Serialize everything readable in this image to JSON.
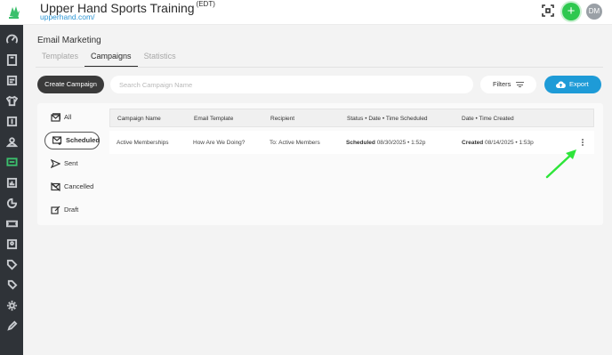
{
  "header": {
    "brand_name": "Upper Hand Sports Training",
    "brand_tz": "(EDT)",
    "brand_url": "upperhand.com/",
    "avatar_initials": "DM",
    "add_label": "+"
  },
  "sidebar": {
    "items": [
      {
        "icon": "dashboard-icon",
        "active": false
      },
      {
        "icon": "book-icon",
        "active": false
      },
      {
        "icon": "calendar-icon",
        "active": false
      },
      {
        "icon": "shirt-icon",
        "active": false
      },
      {
        "icon": "dollar-icon",
        "active": false
      },
      {
        "icon": "users-icon",
        "active": false
      },
      {
        "icon": "message-icon",
        "active": true
      },
      {
        "icon": "reports-icon",
        "active": false
      },
      {
        "icon": "chart-icon",
        "active": false
      },
      {
        "icon": "ticket-icon",
        "active": false
      },
      {
        "icon": "id-card-icon",
        "active": false
      },
      {
        "icon": "tag-icon",
        "active": false
      },
      {
        "icon": "tags-icon",
        "active": false
      },
      {
        "icon": "gear-icon",
        "active": false
      },
      {
        "icon": "edit-icon",
        "active": false
      }
    ]
  },
  "page": {
    "title": "Email Marketing",
    "tabs": [
      "Templates",
      "Campaigns",
      "Statistics"
    ],
    "active_tab": "Campaigns"
  },
  "toolbar": {
    "create_label": "Create Campaign",
    "search_placeholder": "Search Campaign Name",
    "filters_label": "Filters",
    "export_label": "Export"
  },
  "status_filters": [
    {
      "label": "All",
      "icon": "mail-all-icon",
      "active": false
    },
    {
      "label": "Scheduled",
      "icon": "mail-scheduled-icon",
      "active": true
    },
    {
      "label": "Sent",
      "icon": "send-icon",
      "active": false
    },
    {
      "label": "Cancelled",
      "icon": "mail-cancelled-icon",
      "active": false
    },
    {
      "label": "Draft",
      "icon": "draft-icon",
      "active": false
    }
  ],
  "table": {
    "columns": [
      "Campaign Name",
      "Email Template",
      "Recipient",
      "Status • Date • Time Scheduled",
      "Date • Time Created"
    ],
    "rows": [
      {
        "campaign_name": "Active Memberships",
        "email_template": "How Are We Doing?",
        "recipient": "To: Active Members",
        "status": "Scheduled",
        "scheduled": "08/30/2025 • 1:52p",
        "created_label": "Created",
        "created": "08/14/2025 • 1:53p"
      }
    ]
  },
  "colors": {
    "accent_green": "#2ec84f",
    "export_blue": "#1e9bd7",
    "sidebar_bg": "#2f3338",
    "arrow_green": "#2ee53a"
  }
}
